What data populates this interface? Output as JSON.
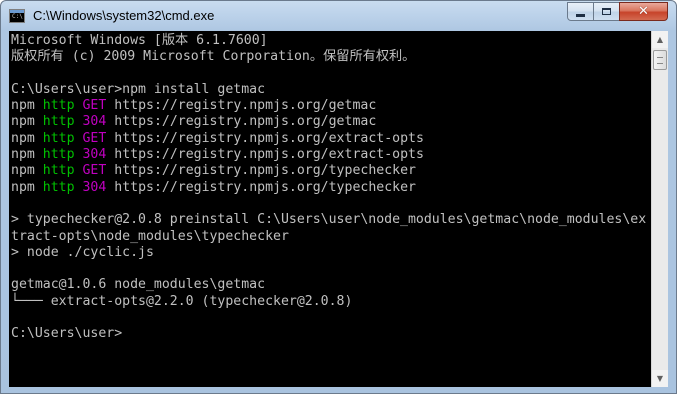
{
  "window": {
    "title": "C:\\Windows\\system32\\cmd.exe",
    "icon": "cmd-icon",
    "icon_text": "C:\\",
    "controls": {
      "minimize_icon": "minimize-icon",
      "maximize_icon": "maximize-icon",
      "close_icon": "close-icon",
      "close_glyph": "✕"
    }
  },
  "colors": {
    "console_bg": "#000000",
    "console_text": "#c0c0c0",
    "http_green": "#00c000",
    "status_magenta": "#c000c0",
    "close_red": "#c7432a"
  },
  "console": {
    "lines": [
      [
        {
          "text": "Microsoft Windows [版本 6.1.7600]"
        }
      ],
      [
        {
          "text": "版权所有 (c) 2009 Microsoft Corporation。保留所有权利。"
        }
      ],
      [
        {
          "text": ""
        }
      ],
      [
        {
          "text": "C:\\Users\\user>npm install getmac"
        }
      ],
      [
        {
          "text": "npm "
        },
        {
          "text": "http",
          "color": "green"
        },
        {
          "text": " "
        },
        {
          "text": "GET",
          "color": "magenta"
        },
        {
          "text": " https://registry.npmjs.org/getmac"
        }
      ],
      [
        {
          "text": "npm "
        },
        {
          "text": "http",
          "color": "green"
        },
        {
          "text": " "
        },
        {
          "text": "304",
          "color": "magenta"
        },
        {
          "text": " https://registry.npmjs.org/getmac"
        }
      ],
      [
        {
          "text": "npm "
        },
        {
          "text": "http",
          "color": "green"
        },
        {
          "text": " "
        },
        {
          "text": "GET",
          "color": "magenta"
        },
        {
          "text": " https://registry.npmjs.org/extract-opts"
        }
      ],
      [
        {
          "text": "npm "
        },
        {
          "text": "http",
          "color": "green"
        },
        {
          "text": " "
        },
        {
          "text": "304",
          "color": "magenta"
        },
        {
          "text": " https://registry.npmjs.org/extract-opts"
        }
      ],
      [
        {
          "text": "npm "
        },
        {
          "text": "http",
          "color": "green"
        },
        {
          "text": " "
        },
        {
          "text": "GET",
          "color": "magenta"
        },
        {
          "text": " https://registry.npmjs.org/typechecker"
        }
      ],
      [
        {
          "text": "npm "
        },
        {
          "text": "http",
          "color": "green"
        },
        {
          "text": " "
        },
        {
          "text": "304",
          "color": "magenta"
        },
        {
          "text": " https://registry.npmjs.org/typechecker"
        }
      ],
      [
        {
          "text": ""
        }
      ],
      [
        {
          "text": "> typechecker@2.0.8 preinstall C:\\Users\\user\\node_modules\\getmac\\node_modules\\ex"
        }
      ],
      [
        {
          "text": "tract-opts\\node_modules\\typechecker"
        }
      ],
      [
        {
          "text": "> node ./cyclic.js"
        }
      ],
      [
        {
          "text": ""
        }
      ],
      [
        {
          "text": "getmac@1.0.6 node_modules\\getmac"
        }
      ],
      [
        {
          "text": "└─── extract-opts@2.2.0 (typechecker@2.0.8)"
        }
      ],
      [
        {
          "text": ""
        }
      ],
      [
        {
          "text": "C:\\Users\\user>"
        }
      ]
    ]
  },
  "scrollbar": {
    "up_icon": "scroll-up-arrow-icon",
    "down_icon": "scroll-down-arrow-icon",
    "up_glyph": "▲",
    "down_glyph": "▼",
    "position_fraction": 0.0
  }
}
